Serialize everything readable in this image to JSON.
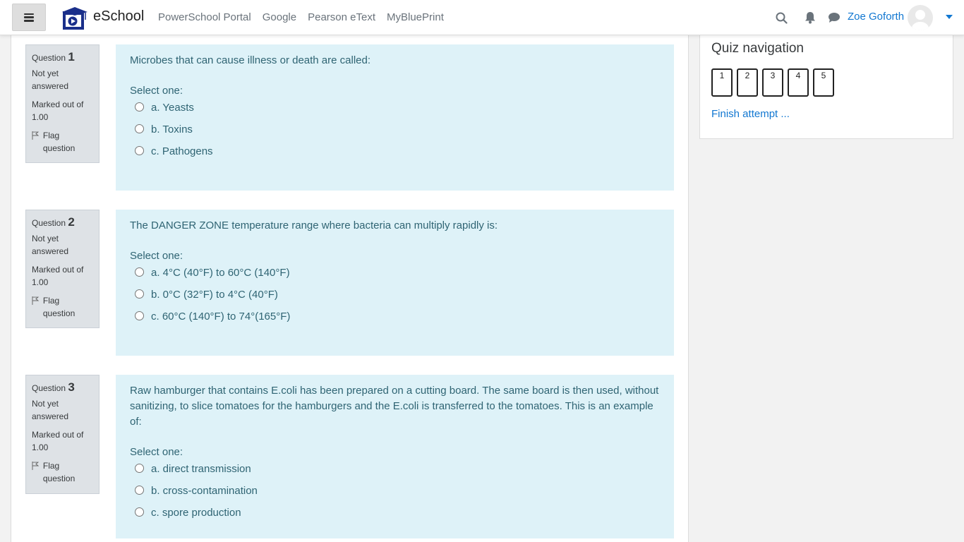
{
  "navbar": {
    "brand": "eSchool",
    "links": [
      "PowerSchool Portal",
      "Google",
      "Pearson eText",
      "MyBluePrint"
    ],
    "user_name": "Zoe Goforth",
    "icons": [
      "search-icon",
      "bell-icon",
      "chat-icon"
    ],
    "accent_color": "#1177d1"
  },
  "questions": [
    {
      "label": "Question",
      "number": "1",
      "state": "Not yet answered",
      "grade": "Marked out of 1.00",
      "flag": "Flag question",
      "text": "Microbes that can cause illness or death are called:",
      "prompt": "Select one:",
      "answers": [
        "a. Yeasts",
        "b. Toxins",
        "c. Pathogens"
      ]
    },
    {
      "label": "Question",
      "number": "2",
      "state": "Not yet answered",
      "grade": "Marked out of 1.00",
      "flag": "Flag question",
      "text": "The DANGER ZONE temperature range where bacteria can multiply rapidly is:",
      "prompt": "Select one:",
      "answers": [
        "a. 4°C (40°F) to 60°C (140°F)",
        "b. 0°C (32°F) to 4°C (40°F)",
        "c. 60°C (140°F) to 74°(165°F)"
      ]
    },
    {
      "label": "Question",
      "number": "3",
      "state": "Not yet answered",
      "grade": "Marked out of 1.00",
      "flag": "Flag question",
      "text": "Raw hamburger that contains E.coli has been prepared on a cutting board. The same board is then used, without sanitizing, to slice tomatoes for the hamburgers and the E.coli is transferred to the tomatoes. This is an example of:",
      "prompt": "Select one:",
      "answers": [
        "a. direct transmission",
        "b. cross-contamination",
        "c. spore production"
      ]
    }
  ],
  "sidebar": {
    "title": "Quiz navigation",
    "buttons": [
      "1",
      "2",
      "3",
      "4",
      "5"
    ],
    "finish": "Finish attempt ..."
  }
}
